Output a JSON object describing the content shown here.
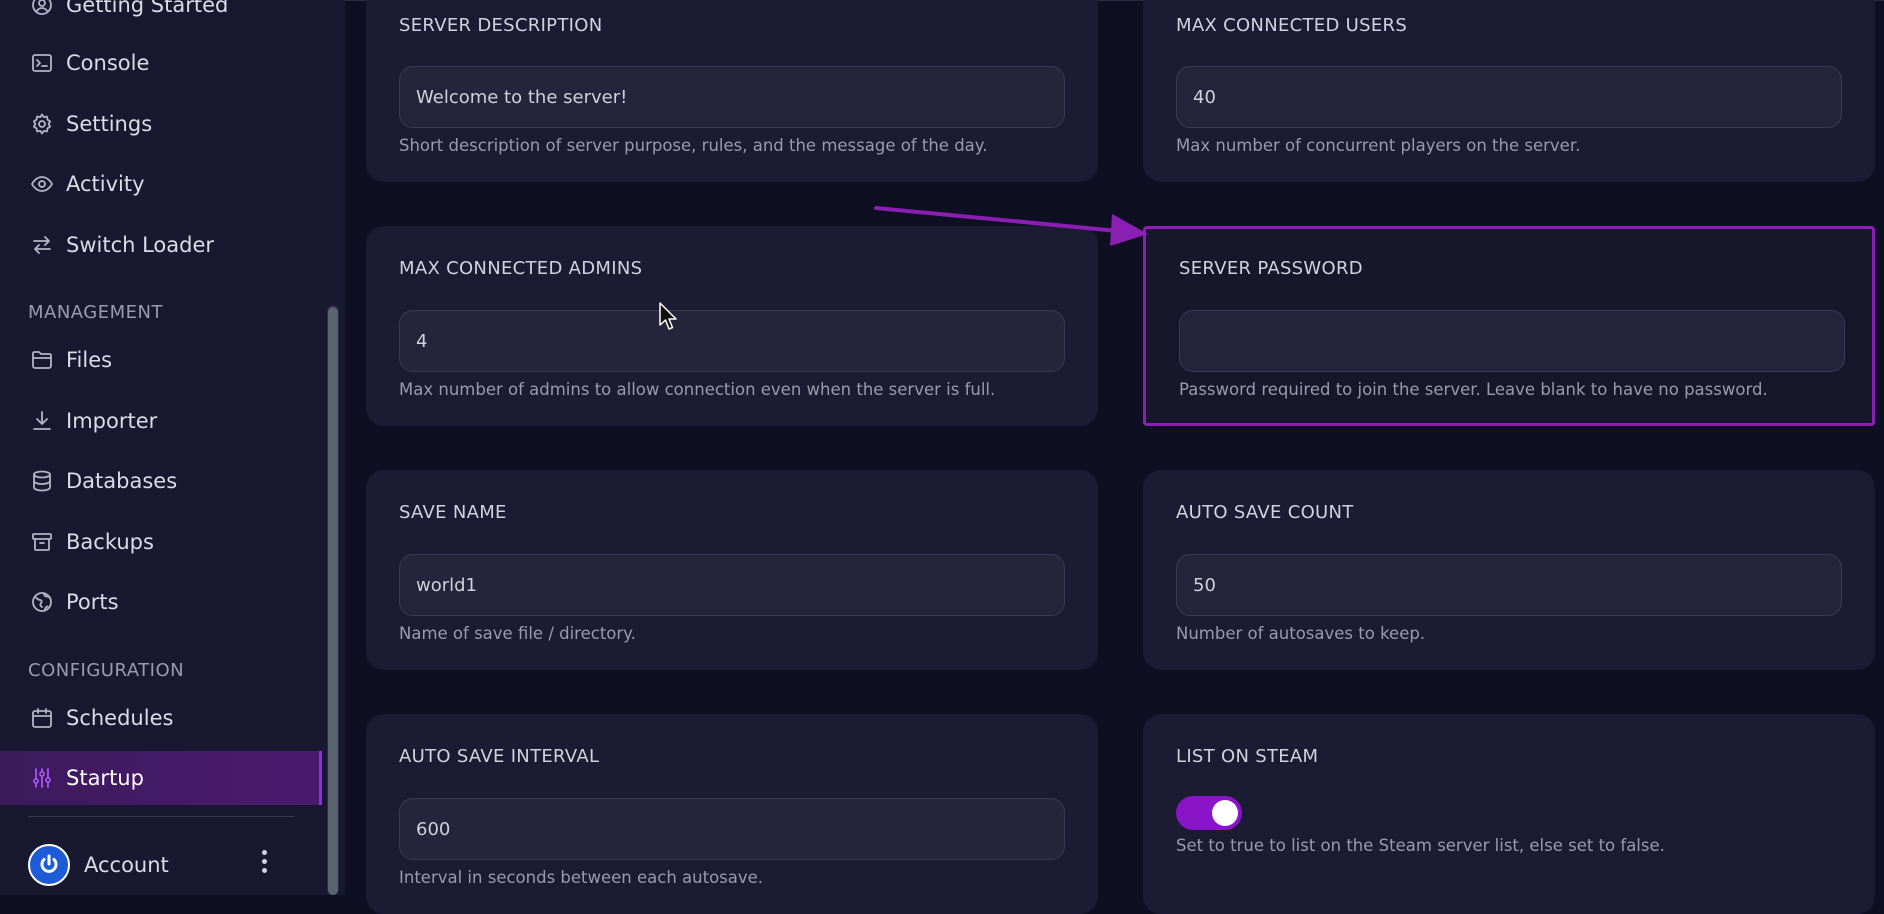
{
  "sidebar": {
    "items": [
      {
        "label": "Getting Started",
        "icon": "user-circle-icon"
      },
      {
        "label": "Console",
        "icon": "terminal-icon"
      },
      {
        "label": "Settings",
        "icon": "gear-icon"
      },
      {
        "label": "Activity",
        "icon": "eye-icon"
      },
      {
        "label": "Switch Loader",
        "icon": "switch-arrows-icon"
      }
    ],
    "management_title": "MANAGEMENT",
    "management_items": [
      {
        "label": "Files",
        "icon": "folder-icon"
      },
      {
        "label": "Importer",
        "icon": "download-icon"
      },
      {
        "label": "Databases",
        "icon": "database-icon"
      },
      {
        "label": "Backups",
        "icon": "archive-icon"
      },
      {
        "label": "Ports",
        "icon": "globe-icon"
      }
    ],
    "configuration_title": "CONFIGURATION",
    "configuration_items": [
      {
        "label": "Schedules",
        "icon": "calendar-icon"
      },
      {
        "label": "Startup",
        "icon": "sliders-icon",
        "active": true
      }
    ],
    "account_label": "Account"
  },
  "cards": {
    "server_description": {
      "label": "SERVER DESCRIPTION",
      "value": "Welcome to the server!",
      "help": "Short description of server purpose, rules, and the message of the day."
    },
    "max_connected_users": {
      "label": "MAX CONNECTED USERS",
      "value": "40",
      "help": "Max number of concurrent players on the server."
    },
    "max_connected_admins": {
      "label": "MAX CONNECTED ADMINS",
      "value": "4",
      "help": "Max number of admins to allow connection even when the server is full."
    },
    "server_password": {
      "label": "SERVER PASSWORD",
      "value": "",
      "help": "Password required to join the server. Leave blank to have no password."
    },
    "save_name": {
      "label": "SAVE NAME",
      "value": "world1",
      "help": "Name of save file / directory."
    },
    "auto_save_count": {
      "label": "AUTO SAVE COUNT",
      "value": "50",
      "help": "Number of autosaves to keep."
    },
    "auto_save_interval": {
      "label": "AUTO SAVE INTERVAL",
      "value": "600",
      "help": "Interval in seconds between each autosave."
    },
    "list_on_steam": {
      "label": "LIST ON STEAM",
      "enabled": true,
      "help": "Set to true to list on the Steam server list, else set to false."
    }
  },
  "colors": {
    "accent": "#8e2de2",
    "highlight_border": "#8b1fb4",
    "annotation_arrow": "#8b1fb4"
  }
}
